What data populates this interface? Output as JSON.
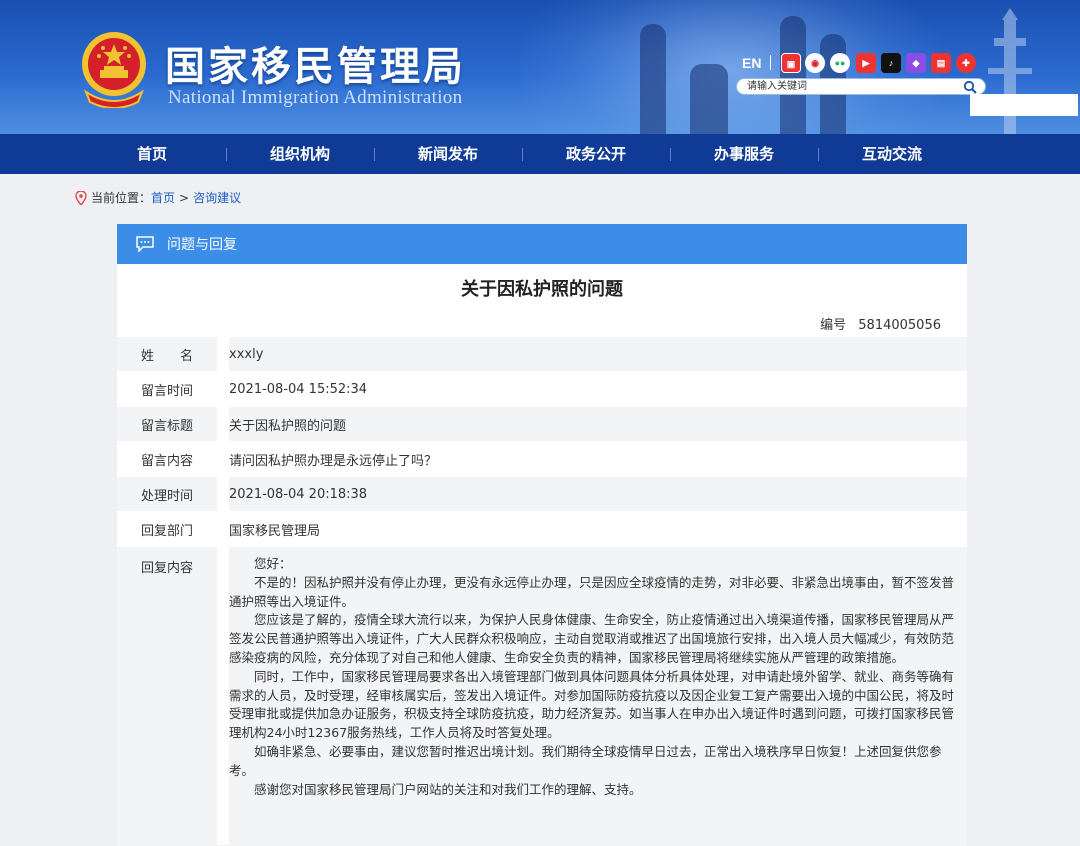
{
  "header": {
    "title": "国家移民管理局",
    "subtitle": "National Immigration Administration",
    "lang_en": "EN",
    "social_icons": [
      "weibo-app-icon",
      "weibo-icon",
      "wechat-icon",
      "toutiao-icon",
      "douyin-icon",
      "kuaishou-icon",
      "bilibili-icon",
      "app-icon"
    ],
    "search_placeholder": "请输入关键词"
  },
  "nav": {
    "items": [
      "首页",
      "组织机构",
      "新闻发布",
      "政务公开",
      "办事服务",
      "互动交流"
    ]
  },
  "breadcrumb": {
    "prefix": "当前位置：",
    "home": "首页",
    "separator": ">",
    "current": "咨询建议"
  },
  "panel": {
    "header_label": "问题与回复",
    "title": "关于因私护照的问题",
    "number_label": "编号",
    "number_value": "5814005056",
    "fields": {
      "name_label": "姓　　名",
      "name_value": "xxxly",
      "msg_time_label": "留言时间",
      "msg_time_value": "2021-08-04 15:52:34",
      "msg_title_label": "留言标题",
      "msg_title_value": "关于因私护照的问题",
      "msg_content_label": "留言内容",
      "msg_content_value": "请问因私护照办理是永远停止了吗？",
      "handle_time_label": "处理时间",
      "handle_time_value": "2021-08-04 20:18:38",
      "reply_dept_label": "回复部门",
      "reply_dept_value": "国家移民管理局",
      "reply_content_label": "回复内容"
    },
    "reply_paragraphs": [
      "您好：",
      "不是的！因私护照并没有停止办理，更没有永远停止办理，只是因应全球疫情的走势，对非必要、非紧急出境事由，暂不签发普通护照等出入境证件。",
      "您应该是了解的，疫情全球大流行以来，为保护人民身体健康、生命安全，防止疫情通过出入境渠道传播，国家移民管理局从严签发公民普通护照等出入境证件，广大人民群众积极响应，主动自觉取消或推迟了出国境旅行安排，出入境人员大幅减少，有效防范感染疫病的风险，充分体现了对自己和他人健康、生命安全负责的精神，国家移民管理局将继续实施从严管理的政策措施。",
      "同时，工作中，国家移民管理局要求各出入境管理部门做到具体问题具体分析具体处理，对申请赴境外留学、就业、商务等确有需求的人员，及时受理，经审核属实后，签发出入境证件。对参加国际防疫抗疫以及因企业复工复产需要出入境的中国公民，将及时受理审批或提供加急办证服务，积极支持全球防疫抗疫，助力经济复苏。如当事人在申办出入境证件时遇到问题，可拨打国家移民管理机构24小时12367服务热线，工作人员将及时答复处理。",
      "如确非紧急、必要事由，建议您暂时推迟出境计划。我们期待全球疫情早日过去，正常出入境秩序早日恢复！上述回复供您参考。",
      "感谢您对国家移民管理局门户网站的关注和对我们工作的理解、支持。"
    ]
  },
  "colors": {
    "nav_bg": "#0f3a96",
    "panel_header_bg": "#3b8de8",
    "link": "#1e5cc2"
  }
}
